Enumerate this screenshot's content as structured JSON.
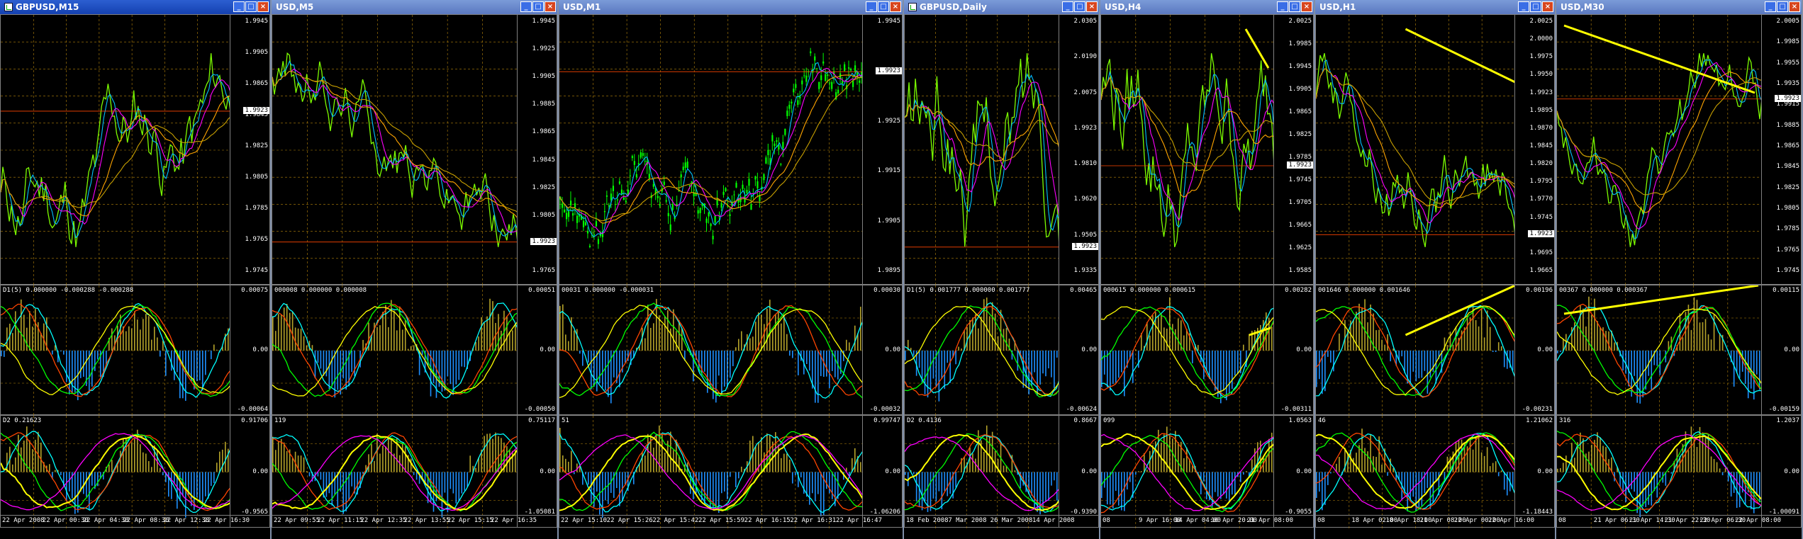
{
  "windows": [
    {
      "title": "GBPUSD,M15",
      "active": true,
      "price": [
        "1.9945",
        "1.9905",
        "1.9865",
        "1.9845",
        "1.9825",
        "1.9805",
        "1.9785",
        "1.9765",
        "1.9745"
      ],
      "current": "1.9923",
      "ind1": {
        "label": "D1(5) 0.000000 -0.000288 -0.000288",
        "scale": [
          "0.00075",
          "0.00",
          "-0.00064"
        ]
      },
      "ind2": {
        "label": "D2 0.21623",
        "scale": [
          "0.91706",
          "0.00",
          "-0.9565"
        ]
      },
      "time": [
        "22 Apr 2008",
        "22 Apr 00:30",
        "22 Apr 04:30",
        "22 Apr 08:30",
        "22 Apr 12:30",
        "22 Apr 16:30"
      ]
    },
    {
      "title": "USD,M5",
      "active": false,
      "price": [
        "1.9945",
        "1.9925",
        "1.9905",
        "1.9885",
        "1.9865",
        "1.9845",
        "1.9825",
        "1.9805",
        "1.9785",
        "1.9765"
      ],
      "current": "1.9923",
      "ind1": {
        "label": "000008 0.000000 0.000008",
        "scale": [
          "0.00051",
          "0.00",
          "-0.00050"
        ]
      },
      "ind2": {
        "label": "119",
        "scale": [
          "0.75117",
          "0.00",
          "-1.05081"
        ]
      },
      "time": [
        "22 Apr 09:55",
        "22 Apr 11:15",
        "22 Apr 12:35",
        "22 Apr 13:55",
        "22 Apr 15:15",
        "22 Apr 16:35"
      ]
    },
    {
      "title": "USD,M1",
      "active": false,
      "price": [
        "1.9945",
        "1.9935",
        "1.9925",
        "1.9915",
        "1.9905",
        "1.9895"
      ],
      "current": "1.9923",
      "ind1": {
        "label": "00031 0.000000 -0.000031",
        "scale": [
          "0.00030",
          "0.00",
          "-0.00032"
        ]
      },
      "ind2": {
        "label": "51",
        "scale": [
          "0.99747",
          "0.00",
          "-1.06206"
        ]
      },
      "time": [
        "22 Apr 15:10",
        "22 Apr 15:26",
        "22 Apr 15:42",
        "22 Apr 15:59",
        "22 Apr 16:15",
        "22 Apr 16:31",
        "22 Apr 16:47"
      ]
    },
    {
      "title": "GBPUSD,Daily",
      "active": false,
      "price": [
        "2.0305",
        "2.0190",
        "2.0075",
        "1.9923",
        "1.9810",
        "1.9620",
        "1.9505",
        "1.9335"
      ],
      "current": "1.9923",
      "ind1": {
        "label": "D1(5) 0.001777 0.000000 0.001777",
        "scale": [
          "0.00465",
          "0.00",
          "-0.00624"
        ]
      },
      "ind2": {
        "label": "D2 0.4136",
        "scale": [
          "0.8667",
          "0.00",
          "-0.9390"
        ]
      },
      "time": [
        "18 Feb 2008",
        "7 Mar 2008",
        "26 Mar 2008",
        "14 Apr 2008"
      ]
    },
    {
      "title": "USD,H4",
      "active": false,
      "price": [
        "2.0025",
        "1.9985",
        "1.9945",
        "1.9905",
        "1.9865",
        "1.9825",
        "1.9785",
        "1.9745",
        "1.9705",
        "1.9665",
        "1.9625",
        "1.9585"
      ],
      "current": "1.9923",
      "ind1": {
        "label": "000615 0.000000 0.000615",
        "scale": [
          "0.00282",
          "0.00",
          "-0.00311"
        ]
      },
      "ind2": {
        "label": "099",
        "scale": [
          "1.0563",
          "0.00",
          "-0.9055"
        ]
      },
      "time": [
        "08",
        "9 Apr 16:00",
        "14 Apr 04:00",
        "16 Apr 20:00",
        "21 Apr 08:00"
      ]
    },
    {
      "title": "USD,H1",
      "active": false,
      "price": [
        "2.0025",
        "2.0000",
        "1.9975",
        "1.9950",
        "1.9923",
        "1.9895",
        "1.9870",
        "1.9845",
        "1.9820",
        "1.9795",
        "1.9770",
        "1.9745",
        "1.9720",
        "1.9695",
        "1.9665"
      ],
      "current": "1.9923",
      "ind1": {
        "label": "001646 0.000000 0.001646",
        "scale": [
          "0.00196",
          "0.00",
          "-0.00231"
        ]
      },
      "ind2": {
        "label": "46",
        "scale": [
          "1.21062",
          "0.00",
          "-1.18443"
        ]
      },
      "time": [
        "08",
        "18 Apr 02:00",
        "18 Apr 18:00",
        "21 Apr 08:00",
        "22 Apr 00:00",
        "22 Apr 16:00"
      ]
    },
    {
      "title": "USD,M30",
      "active": false,
      "price": [
        "2.0005",
        "1.9985",
        "1.9955",
        "1.9935",
        "1.9915",
        "1.9885",
        "1.9865",
        "1.9845",
        "1.9825",
        "1.9805",
        "1.9785",
        "1.9765",
        "1.9745"
      ],
      "current": "1.9923",
      "ind1": {
        "label": "00367 0.000000 0.000367",
        "scale": [
          "0.00115",
          "0.00",
          "-0.00159"
        ]
      },
      "ind2": {
        "label": "316",
        "scale": [
          "1.2037",
          "0.00",
          "-1.00091"
        ]
      },
      "time": [
        "08",
        "21 Apr 06:30",
        "21 Apr 14:30",
        "21 Apr 22:30",
        "22 Apr 06:30",
        "22 Apr 08:00"
      ]
    }
  ],
  "colors": {
    "grid": "#b8860b",
    "candleUp": "#00ff00",
    "close": "#7cfc00",
    "ma1": "#00bfff",
    "ma2": "#ff00ff",
    "ma3": "#ffa500",
    "ma4": "#c8a000",
    "hline": "#ff4500",
    "trend": "#ffff00",
    "histUp": "#b5a32a",
    "histDn": "#1e90ff",
    "osc1": "#00ffff",
    "osc2": "#ff4500",
    "osc3": "#00ff00",
    "osc4": "#ffff00",
    "arrowDn": "#00bfff",
    "arrowRed": "#ff3300"
  }
}
